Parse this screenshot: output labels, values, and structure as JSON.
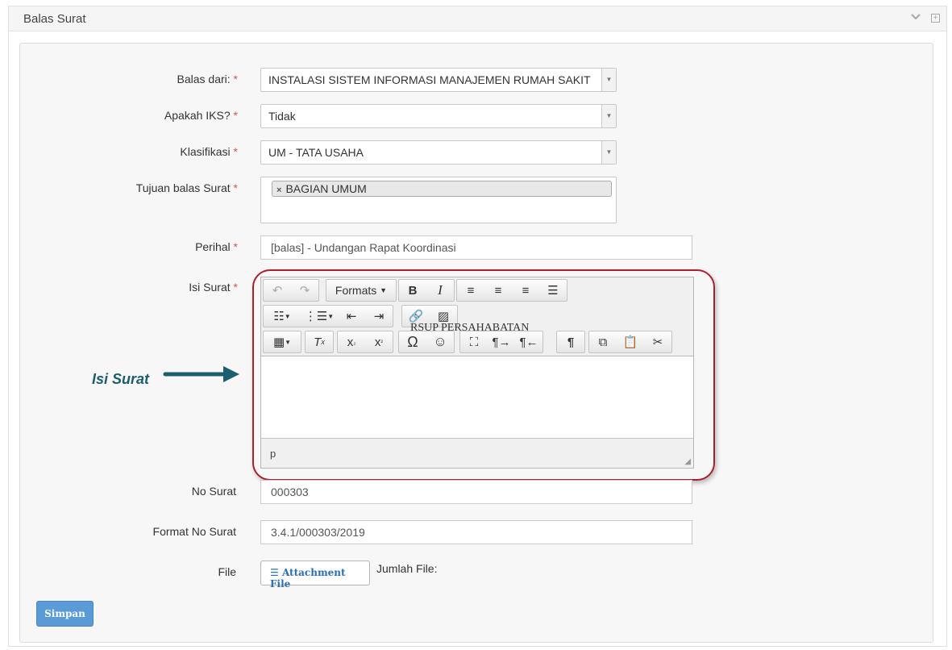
{
  "panel": {
    "title": "Balas Surat",
    "collapse_icon": "chevron-down-icon",
    "expand_icon": "plus-box-icon"
  },
  "form": {
    "balas_dari": {
      "label": "Balas dari:",
      "value": "INSTALASI SISTEM INFORMASI MANAJEMEN RUMAH SAKIT"
    },
    "apakah_iks": {
      "label": "Apakah IKS?",
      "value": "Tidak"
    },
    "klasifikasi": {
      "label": "Klasifikasi",
      "value": "UM - TATA USAHA"
    },
    "tujuan": {
      "label": "Tujuan balas Surat",
      "tags": [
        "BAGIAN UMUM"
      ]
    },
    "perihal": {
      "label": "Perihal",
      "value": "[balas] - Undangan Rapat Koordinasi"
    },
    "isi_surat": {
      "label": "Isi Surat"
    },
    "no_surat": {
      "label": "No Surat",
      "value": "000303"
    },
    "format_no_surat": {
      "label": "Format No Surat",
      "value": "3.4.1/000303/2019"
    },
    "file": {
      "label": "File",
      "button_label": "Attachment File",
      "count_label": "Jumlah File:"
    },
    "required_mark": "*",
    "submit_label": "Simpan"
  },
  "editor": {
    "formats_label": "Formats",
    "status_path": "p",
    "watermark": "RSUP PERSAHABATAN"
  },
  "annotation": {
    "text": "Isi Surat",
    "color": "#1d5d6e"
  },
  "colors": {
    "highlight_border": "#a8202f",
    "primary_button": "#5b9bd5",
    "required": "#d9534f"
  }
}
